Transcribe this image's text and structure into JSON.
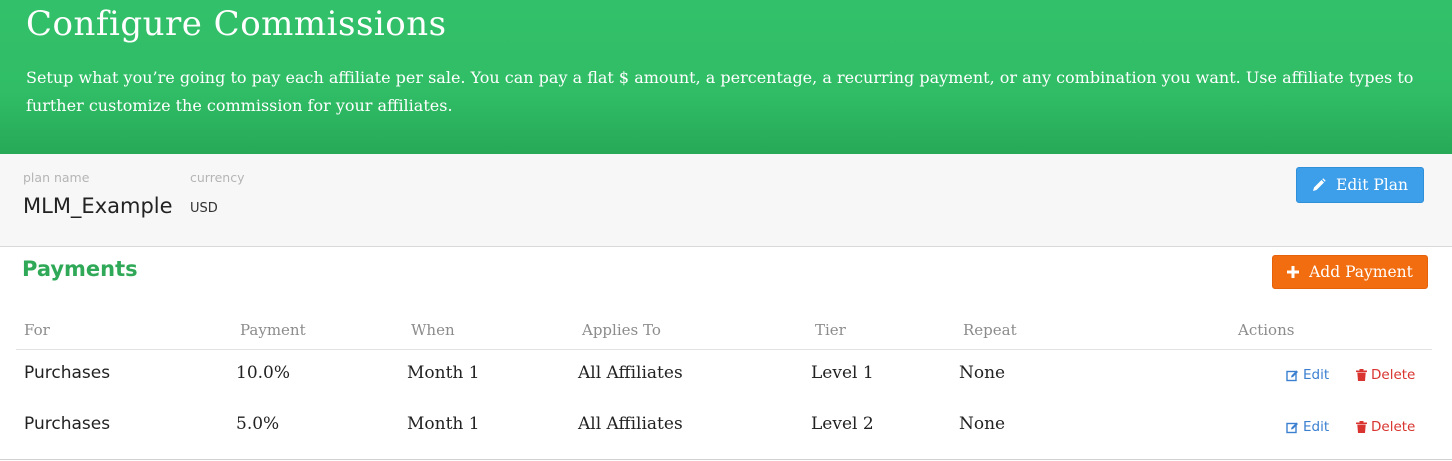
{
  "header": {
    "title": "Configure Commissions",
    "description": "Setup what you’re going to pay each affiliate per sale. You can pay a flat $ amount, a percentage, a recurring payment, or any combination you want. Use affiliate types to further customize the commission for your affiliates.",
    "background_color": "#31bd66"
  },
  "plan": {
    "name_label": "plan name",
    "name": "MLM_Example",
    "currency_label": "currency",
    "currency": "USD",
    "edit_button_label": "Edit Plan",
    "edit_icon": "pencil-icon"
  },
  "payments": {
    "title": "Payments",
    "add_button_label": "Add Payment",
    "add_icon": "plus-icon",
    "columns": [
      "For",
      "Payment",
      "When",
      "Applies To",
      "Tier",
      "Repeat",
      "Actions"
    ],
    "rows": [
      {
        "for": "Purchases",
        "payment": "10.0%",
        "when": "Month 1",
        "applies_to": "All Affiliates",
        "tier": "Level 1",
        "repeat": "None",
        "edit_label": "Edit",
        "delete_label": "Delete"
      },
      {
        "for": "Purchases",
        "payment": "5.0%",
        "when": "Month 1",
        "applies_to": "All Affiliates",
        "tier": "Level 2",
        "repeat": "None",
        "edit_label": "Edit",
        "delete_label": "Delete"
      }
    ]
  },
  "colors": {
    "accent_green": "#2fa957",
    "edit_button": "#3d9ee9",
    "add_button": "#f26d0f",
    "edit_link": "#3a7fd0",
    "delete_link": "#d9342f"
  }
}
